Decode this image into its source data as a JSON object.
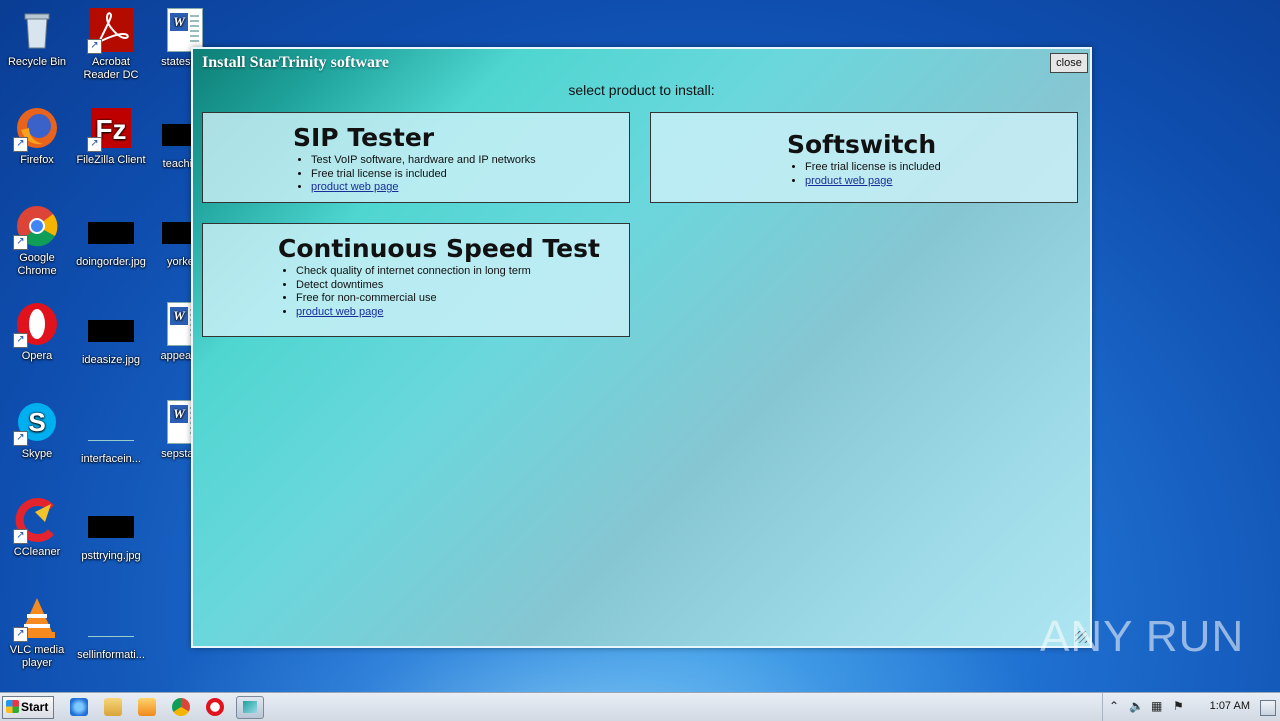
{
  "desktop": {
    "icons": [
      {
        "label": "Recycle Bin",
        "icon": "recycle-bin-icon"
      },
      {
        "label": "Acrobat Reader DC",
        "icon": "acrobat-icon"
      },
      {
        "label": "statesfe...",
        "icon": "word-doc-icon"
      },
      {
        "label": "Firefox",
        "icon": "firefox-icon"
      },
      {
        "label": "FileZilla Client",
        "icon": "filezilla-icon"
      },
      {
        "label": "teachin...",
        "icon": "image-thumb-icon"
      },
      {
        "label": "Google Chrome",
        "icon": "chrome-icon"
      },
      {
        "label": "doingorder.jpg",
        "icon": "image-thumb-icon"
      },
      {
        "label": "yorke...",
        "icon": "image-thumb-icon"
      },
      {
        "label": "Opera",
        "icon": "opera-icon"
      },
      {
        "label": "ideasize.jpg",
        "icon": "image-thumb-icon"
      },
      {
        "label": "appears...",
        "icon": "word-doc-icon"
      },
      {
        "label": "Skype",
        "icon": "skype-icon"
      },
      {
        "label": "interfacein...",
        "icon": "blank-file-icon"
      },
      {
        "label": "sepstan...",
        "icon": "word-doc-icon"
      },
      {
        "label": "CCleaner",
        "icon": "ccleaner-icon"
      },
      {
        "label": "psttrying.jpg",
        "icon": "image-thumb-icon"
      },
      {
        "label": "VLC media player",
        "icon": "vlc-icon"
      },
      {
        "label": "sellinformati...",
        "icon": "blank-file-icon"
      }
    ]
  },
  "installer": {
    "title": "Install StarTrinity software",
    "close_label": "close",
    "subtitle": "select product to install:",
    "products": [
      {
        "name": "SIP Tester",
        "features": [
          "Test VoIP software, hardware and IP networks",
          "Free trial license is included"
        ],
        "link": "product web page"
      },
      {
        "name": "Softswitch",
        "features": [
          "Free trial license is included"
        ],
        "link": "product web page"
      },
      {
        "name": "Continuous Speed Test",
        "features": [
          "Check quality of internet connection in long term",
          "Detect downtimes",
          "Free for non-commercial use"
        ],
        "link": "product web page"
      }
    ]
  },
  "watermark": "ANY RUN",
  "taskbar": {
    "start_label": "Start",
    "clock": "1:07 AM",
    "pinned": [
      "ie-icon",
      "explorer-icon",
      "media-player-icon",
      "chrome-icon",
      "opera-icon",
      "startrinity-icon"
    ]
  },
  "colors": {
    "desktop_blue": "#1e6fd0",
    "window_teal": "#4fd6d0",
    "link_blue": "#1a2d96"
  }
}
